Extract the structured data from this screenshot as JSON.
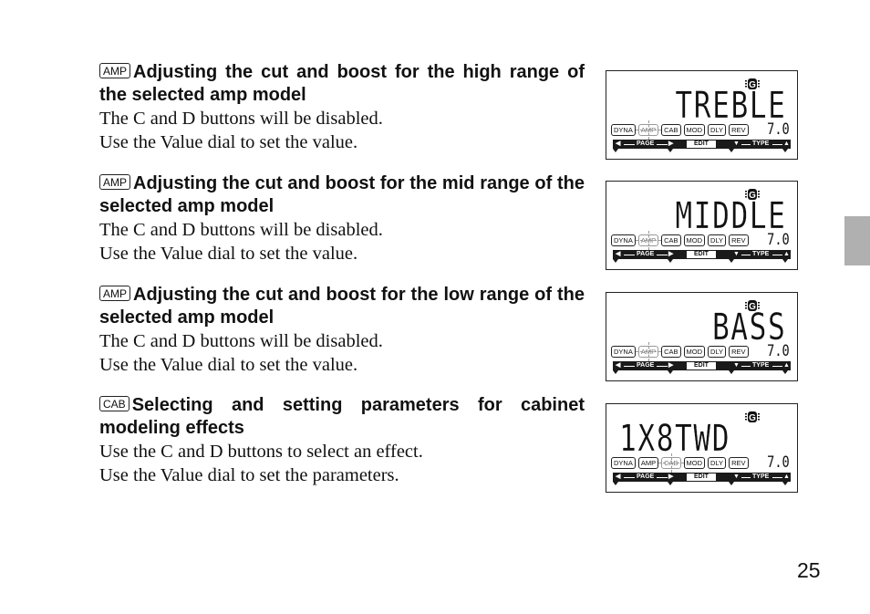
{
  "page": {
    "number": "25",
    "side_tab_color": "#b0b0b0"
  },
  "sections": [
    {
      "tag": "AMP",
      "heading": "Adjusting the cut and boost for the high range of the selected amp model",
      "lines": [
        "The C and D buttons will be disabled.",
        "Use the Value dial to set the value."
      ],
      "lcd": {
        "text": "TREBLE",
        "value": "7.0",
        "active_tab": "AMP"
      }
    },
    {
      "tag": "AMP",
      "heading": "Adjusting the cut and boost for the mid range of the selected amp model",
      "lines": [
        "The C and D buttons will be disabled.",
        "Use the Value dial to set the value."
      ],
      "lcd": {
        "text": "MIDDLE",
        "value": "7.0",
        "active_tab": "AMP"
      }
    },
    {
      "tag": "AMP",
      "heading": "Adjusting the cut and boost for the low range of the selected amp model",
      "lines": [
        "The C and D buttons will be disabled.",
        "Use the Value dial to set the value."
      ],
      "lcd": {
        "text": "BASS",
        "value": "7.0",
        "active_tab": "AMP"
      }
    },
    {
      "tag": "CAB",
      "heading": "Selecting and setting parameters for cabinet modeling effects",
      "lines": [
        "Use the C and D buttons to select an effect.",
        "Use the Value dial to set the parameters."
      ],
      "lcd": {
        "text": "1X8TWD",
        "value": "7.0",
        "active_tab": "CAB"
      }
    }
  ],
  "lcd_common": {
    "effect_tabs": [
      "DYNA",
      "AMP",
      "CAB",
      "MOD",
      "DLY",
      "REV"
    ],
    "page_label": "PAGE",
    "edit_label": "EDIT",
    "type_label": "TYPE",
    "icons": {
      "g": "guitar-chip-icon",
      "left": "arrow-left-icon",
      "right": "arrow-right-icon",
      "down": "arrow-down-icon",
      "up": "arrow-up-icon"
    }
  }
}
